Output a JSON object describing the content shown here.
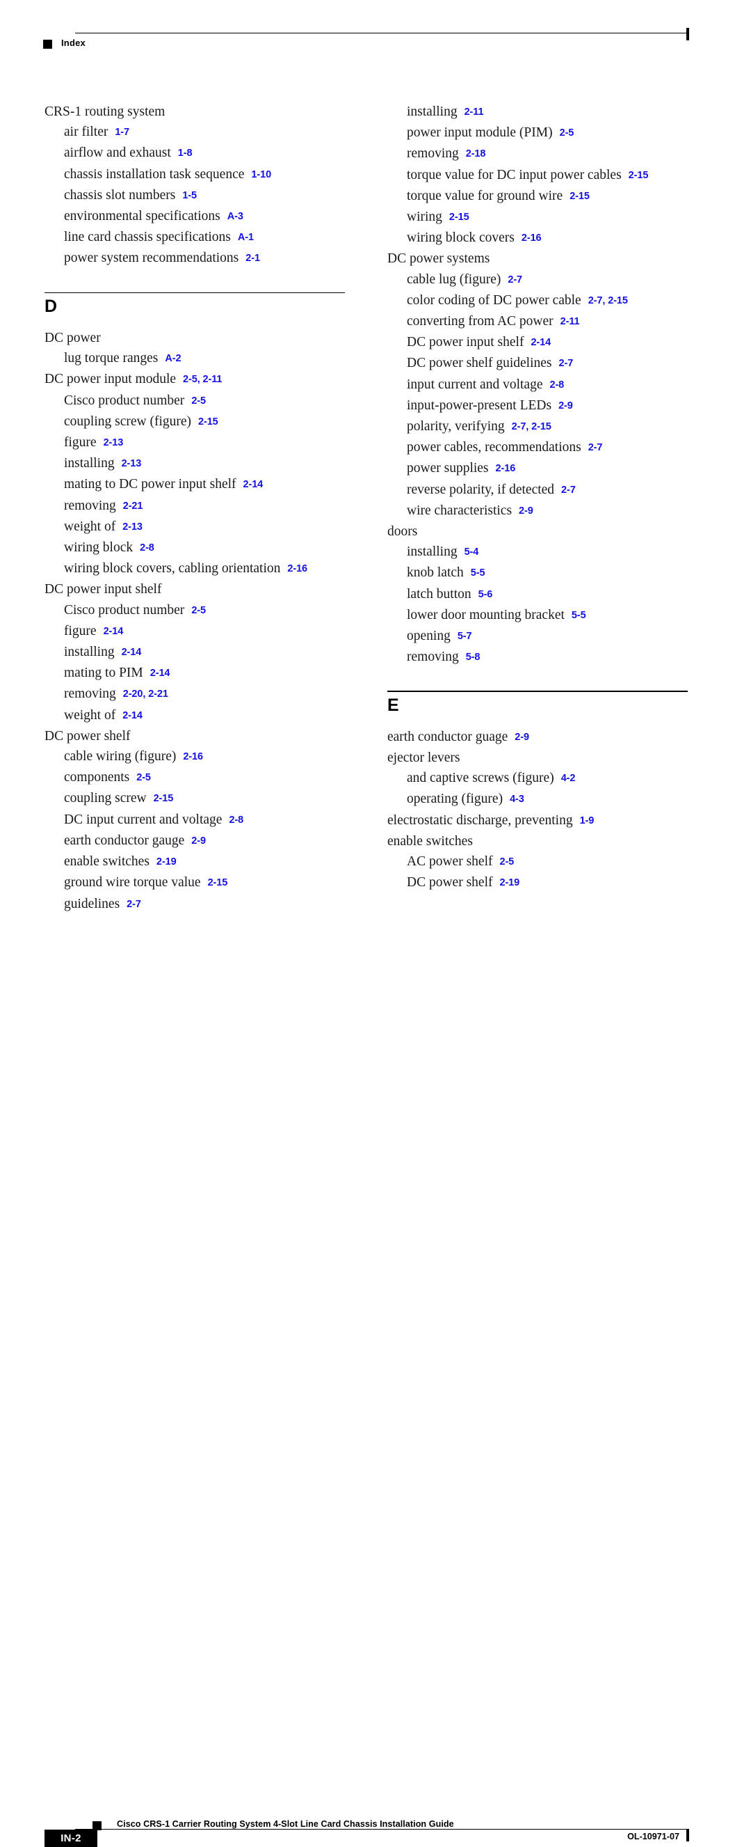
{
  "header": {
    "title": "Index",
    "marker_icon": "black-square-icon"
  },
  "footer": {
    "page_number": "IN-2",
    "document_title": "Cisco CRS-1 Carrier Routing System 4-Slot Line Card Chassis Installation Guide",
    "document_id": "OL-10971-07",
    "marker_icon": "black-square-icon"
  },
  "colors": {
    "reference_blue": "#1310e8",
    "text_black": "#1a1a1a",
    "rule_black": "#000000"
  },
  "columns": [
    {
      "name": "left-column",
      "blocks": [
        {
          "type": "entries",
          "entries": [
            {
              "level": 0,
              "term": "CRS-1 routing system",
              "ref": ""
            },
            {
              "level": 1,
              "term": "air filter",
              "ref": "1-7"
            },
            {
              "level": 1,
              "term": "airflow and exhaust",
              "ref": "1-8"
            },
            {
              "level": 1,
              "term": "chassis installation task sequence",
              "ref": "1-10"
            },
            {
              "level": 1,
              "term": "chassis slot numbers",
              "ref": "1-5"
            },
            {
              "level": 1,
              "term": "environmental specifications",
              "ref": "A-3"
            },
            {
              "level": 1,
              "term": "line card chassis specifications",
              "ref": "A-1"
            },
            {
              "level": 1,
              "term": "power system recommendations",
              "ref": "2-1"
            }
          ]
        },
        {
          "type": "section",
          "letter": "D"
        },
        {
          "type": "entries",
          "entries": [
            {
              "level": 0,
              "term": "DC power",
              "ref": ""
            },
            {
              "level": 1,
              "term": "lug torque ranges",
              "ref": "A-2"
            },
            {
              "level": 0,
              "term": "DC power input module",
              "ref": "2-5, 2-11"
            },
            {
              "level": 1,
              "term": "Cisco product number",
              "ref": "2-5"
            },
            {
              "level": 1,
              "term": "coupling screw (figure)",
              "ref": "2-15"
            },
            {
              "level": 1,
              "term": "figure",
              "ref": "2-13"
            },
            {
              "level": 1,
              "term": "installing",
              "ref": "2-13"
            },
            {
              "level": 1,
              "term": "mating to DC power input shelf",
              "ref": "2-14"
            },
            {
              "level": 1,
              "term": "removing",
              "ref": "2-21"
            },
            {
              "level": 1,
              "term": "weight of",
              "ref": "2-13"
            },
            {
              "level": 1,
              "term": "wiring block",
              "ref": "2-8"
            },
            {
              "level": 1,
              "term": "wiring block covers, cabling orientation",
              "ref": "2-16"
            },
            {
              "level": 0,
              "term": "DC power input shelf",
              "ref": ""
            },
            {
              "level": 1,
              "term": "Cisco product number",
              "ref": "2-5"
            },
            {
              "level": 1,
              "term": "figure",
              "ref": "2-14"
            },
            {
              "level": 1,
              "term": "installing",
              "ref": "2-14"
            },
            {
              "level": 1,
              "term": "mating to PIM",
              "ref": "2-14"
            },
            {
              "level": 1,
              "term": "removing",
              "ref": "2-20, 2-21"
            },
            {
              "level": 1,
              "term": "weight of",
              "ref": "2-14"
            },
            {
              "level": 0,
              "term": "DC power shelf",
              "ref": ""
            },
            {
              "level": 1,
              "term": "cable wiring (figure)",
              "ref": "2-16"
            },
            {
              "level": 1,
              "term": "components",
              "ref": "2-5"
            },
            {
              "level": 1,
              "term": "coupling screw",
              "ref": "2-15"
            },
            {
              "level": 1,
              "term": "DC input current and voltage",
              "ref": "2-8"
            },
            {
              "level": 1,
              "term": "earth conductor gauge",
              "ref": "2-9"
            },
            {
              "level": 1,
              "term": "enable switches",
              "ref": "2-19"
            },
            {
              "level": 1,
              "term": "ground wire torque value",
              "ref": "2-15"
            },
            {
              "level": 1,
              "term": "guidelines",
              "ref": "2-7"
            }
          ]
        }
      ]
    },
    {
      "name": "right-column",
      "blocks": [
        {
          "type": "entries",
          "entries": [
            {
              "level": 1,
              "term": "installing",
              "ref": "2-11"
            },
            {
              "level": 1,
              "term": "power input module (PIM)",
              "ref": "2-5"
            },
            {
              "level": 1,
              "term": "removing",
              "ref": "2-18"
            },
            {
              "level": 1,
              "term": "torque value for DC input power cables",
              "ref": "2-15"
            },
            {
              "level": 1,
              "term": "torque value for ground wire",
              "ref": "2-15"
            },
            {
              "level": 1,
              "term": "wiring",
              "ref": "2-15"
            },
            {
              "level": 1,
              "term": "wiring block covers",
              "ref": "2-16"
            },
            {
              "level": 0,
              "term": "DC power systems",
              "ref": ""
            },
            {
              "level": 1,
              "term": "cable lug (figure)",
              "ref": "2-7"
            },
            {
              "level": 1,
              "term": "color coding of DC power cable",
              "ref": "2-7, 2-15"
            },
            {
              "level": 1,
              "term": "converting from AC power",
              "ref": "2-11"
            },
            {
              "level": 1,
              "term": "DC power input shelf",
              "ref": "2-14"
            },
            {
              "level": 1,
              "term": "DC power shelf guidelines",
              "ref": "2-7"
            },
            {
              "level": 1,
              "term": "input current and voltage",
              "ref": "2-8"
            },
            {
              "level": 1,
              "term": "input-power-present LEDs",
              "ref": "2-9"
            },
            {
              "level": 1,
              "term": "polarity, verifying",
              "ref": "2-7, 2-15"
            },
            {
              "level": 1,
              "term": "power cables, recommendations",
              "ref": "2-7"
            },
            {
              "level": 1,
              "term": "power supplies",
              "ref": "2-16"
            },
            {
              "level": 1,
              "term": "reverse polarity, if detected",
              "ref": "2-7"
            },
            {
              "level": 1,
              "term": "wire characteristics",
              "ref": "2-9"
            },
            {
              "level": 0,
              "term": "doors",
              "ref": ""
            },
            {
              "level": 1,
              "term": "installing",
              "ref": "5-4"
            },
            {
              "level": 1,
              "term": "knob latch",
              "ref": "5-5"
            },
            {
              "level": 1,
              "term": "latch button",
              "ref": "5-6"
            },
            {
              "level": 1,
              "term": "lower door mounting bracket",
              "ref": "5-5"
            },
            {
              "level": 1,
              "term": "opening",
              "ref": "5-7"
            },
            {
              "level": 1,
              "term": "removing",
              "ref": "5-8"
            }
          ]
        },
        {
          "type": "section",
          "letter": "E"
        },
        {
          "type": "entries",
          "entries": [
            {
              "level": 0,
              "term": "earth conductor guage",
              "ref": "2-9"
            },
            {
              "level": 0,
              "term": "ejector levers",
              "ref": ""
            },
            {
              "level": 1,
              "term": "and captive screws (figure)",
              "ref": "4-2"
            },
            {
              "level": 1,
              "term": "operating (figure)",
              "ref": "4-3"
            },
            {
              "level": 0,
              "term": "electrostatic discharge, preventing",
              "ref": "1-9"
            },
            {
              "level": 0,
              "term": "enable switches",
              "ref": ""
            },
            {
              "level": 1,
              "term": "AC power shelf",
              "ref": "2-5"
            },
            {
              "level": 1,
              "term": "DC power shelf",
              "ref": "2-19"
            }
          ]
        }
      ]
    }
  ]
}
